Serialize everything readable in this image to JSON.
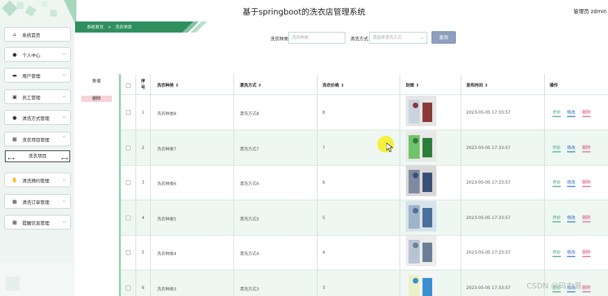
{
  "header": {
    "title": "基于springboot的洗衣店管理系统",
    "user": "管理员 zdmin"
  },
  "sidebar": {
    "items": [
      {
        "label": "系统首页",
        "icon": "home-icon"
      },
      {
        "label": "个人中心",
        "icon": "person-icon"
      },
      {
        "label": "用户管理",
        "icon": "user-card-icon"
      },
      {
        "label": "员工管理",
        "icon": "staff-icon"
      },
      {
        "label": "清洗方式管理",
        "icon": "person-icon"
      },
      {
        "label": "洗衣项目管理",
        "icon": "grid-icon"
      },
      {
        "label": "清洗预约管理",
        "icon": "thumb-icon"
      },
      {
        "label": "清洗订单管理",
        "icon": "grid-icon"
      },
      {
        "label": "提醒信息管理",
        "icon": "grid-icon"
      }
    ],
    "submenu": "洗衣项目"
  },
  "breadcrumb": {
    "home": "系统首页",
    "sep": ">",
    "current": "洗衣项目"
  },
  "search": {
    "label1": "洗衣种类",
    "placeholder1": "洗衣种类",
    "label2": "清洗方式",
    "placeholder2": "请选择清洗方式",
    "button": "查询"
  },
  "actions": {
    "add": "新增",
    "delete": "删除"
  },
  "table": {
    "headers": [
      "序号",
      "洗衣种类",
      "清洗方式",
      "洗衣价格",
      "封面",
      "发布时间",
      "操作"
    ],
    "rows": [
      {
        "no": "1",
        "type": "洗衣种类8",
        "method": "清洗方式8",
        "price": "8",
        "time": "2023-05-05 17:33:57"
      },
      {
        "no": "2",
        "type": "洗衣种类7",
        "method": "清洗方式7",
        "price": "7",
        "time": "2023-05-05 17:33:57"
      },
      {
        "no": "3",
        "type": "洗衣种类6",
        "method": "清洗方式6",
        "price": "6",
        "time": "2023-05-05 17:33:57"
      },
      {
        "no": "4",
        "type": "洗衣种类5",
        "method": "清洗方式5",
        "price": "5",
        "time": "2023-05-05 17:33:57"
      },
      {
        "no": "5",
        "type": "洗衣种类4",
        "method": "清洗方式4",
        "price": "4",
        "time": "2023-05-05 17:33:57"
      },
      {
        "no": "6",
        "type": "洗衣种类3",
        "method": "清洗方式3",
        "price": "3",
        "time": "2023-05-05 17:33:57"
      }
    ],
    "ops": {
      "comment": "评价",
      "edit": "修改",
      "del": "删除"
    }
  },
  "watermark": "CSDN @码力源",
  "colors": {
    "accent": "#9bd3b5",
    "sidebar_bg": "#eef4f1",
    "row_alt": "#eef7f2",
    "search_btn": "#8f9fbf"
  }
}
